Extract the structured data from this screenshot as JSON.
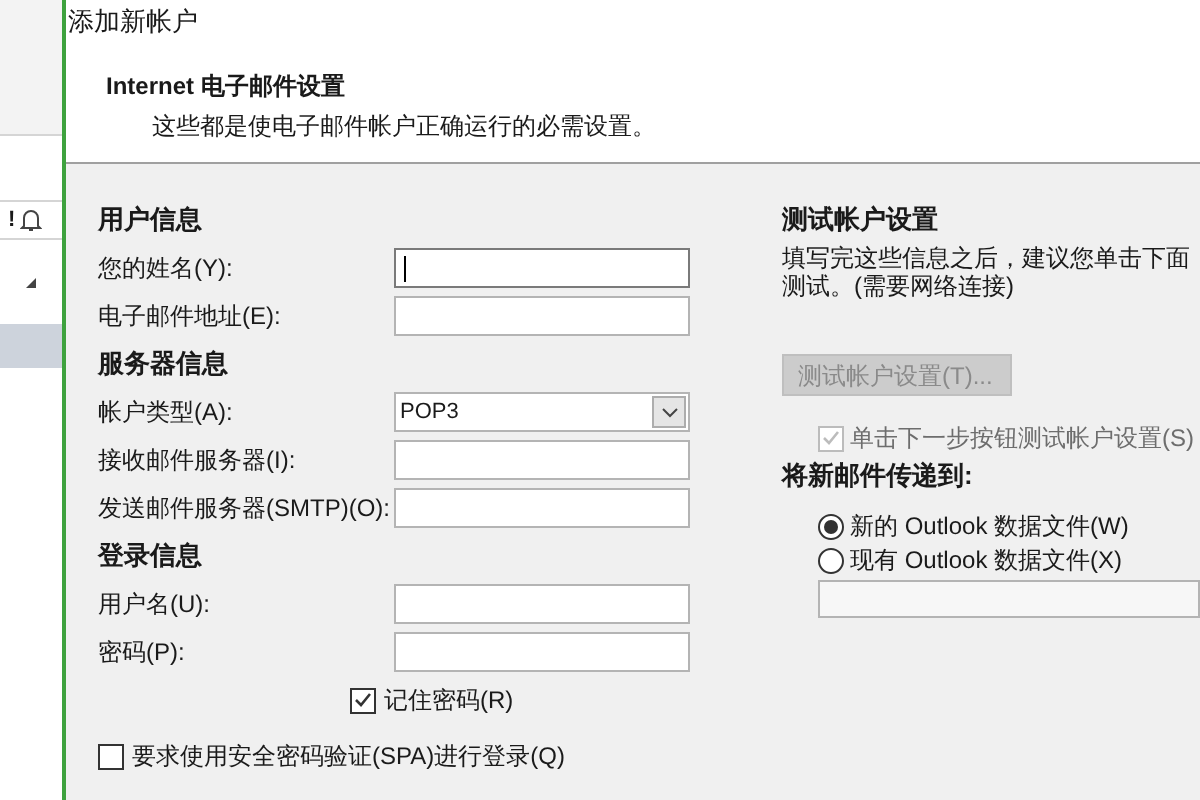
{
  "background_app": {
    "column_marks": [
      "!"
    ]
  },
  "dialog": {
    "title": "添加新帐户",
    "header": {
      "title": "Internet 电子邮件设置",
      "subtitle": "这些都是使电子邮件帐户正确运行的必需设置。"
    },
    "left": [
      {
        "kind": "section",
        "label": "用户信息"
      },
      {
        "kind": "input",
        "label": "您的姓名(Y):",
        "focused": true
      },
      {
        "kind": "input",
        "label": "电子邮件地址(E):",
        "focused": false
      },
      {
        "kind": "section",
        "label": "服务器信息"
      },
      {
        "kind": "select",
        "label": "帐户类型(A):",
        "value": "POP3"
      },
      {
        "kind": "input",
        "label": "接收邮件服务器(I):",
        "focused": false
      },
      {
        "kind": "input",
        "label": "发送邮件服务器(SMTP)(O):",
        "focused": false
      },
      {
        "kind": "section",
        "label": "登录信息"
      },
      {
        "kind": "input",
        "label": "用户名(U):",
        "focused": false
      },
      {
        "kind": "input",
        "label": "密码(P):",
        "focused": false
      },
      {
        "kind": "check",
        "label": "记住密码(R)",
        "checked": true
      },
      {
        "kind": "check_wide",
        "label": "要求使用安全密码验证(SPA)进行登录(Q)",
        "checked": false
      }
    ],
    "right": {
      "title": "测试帐户设置",
      "description": [
        "填写完这些信息之后，建议您单击下面",
        "测试。(需要网络连接)"
      ],
      "test_button": {
        "label": "测试帐户设置(T)...",
        "disabled": true
      },
      "auto_test": {
        "label": "单击下一步按钮测试帐户设置(S)",
        "checked": true,
        "disabled": true
      },
      "deliver_title": "将新邮件传递到:",
      "deliver_options": [
        {
          "label": "新的 Outlook 数据文件(W)",
          "selected": true
        },
        {
          "label": "现有 Outlook 数据文件(X)",
          "selected": false
        }
      ]
    }
  }
}
